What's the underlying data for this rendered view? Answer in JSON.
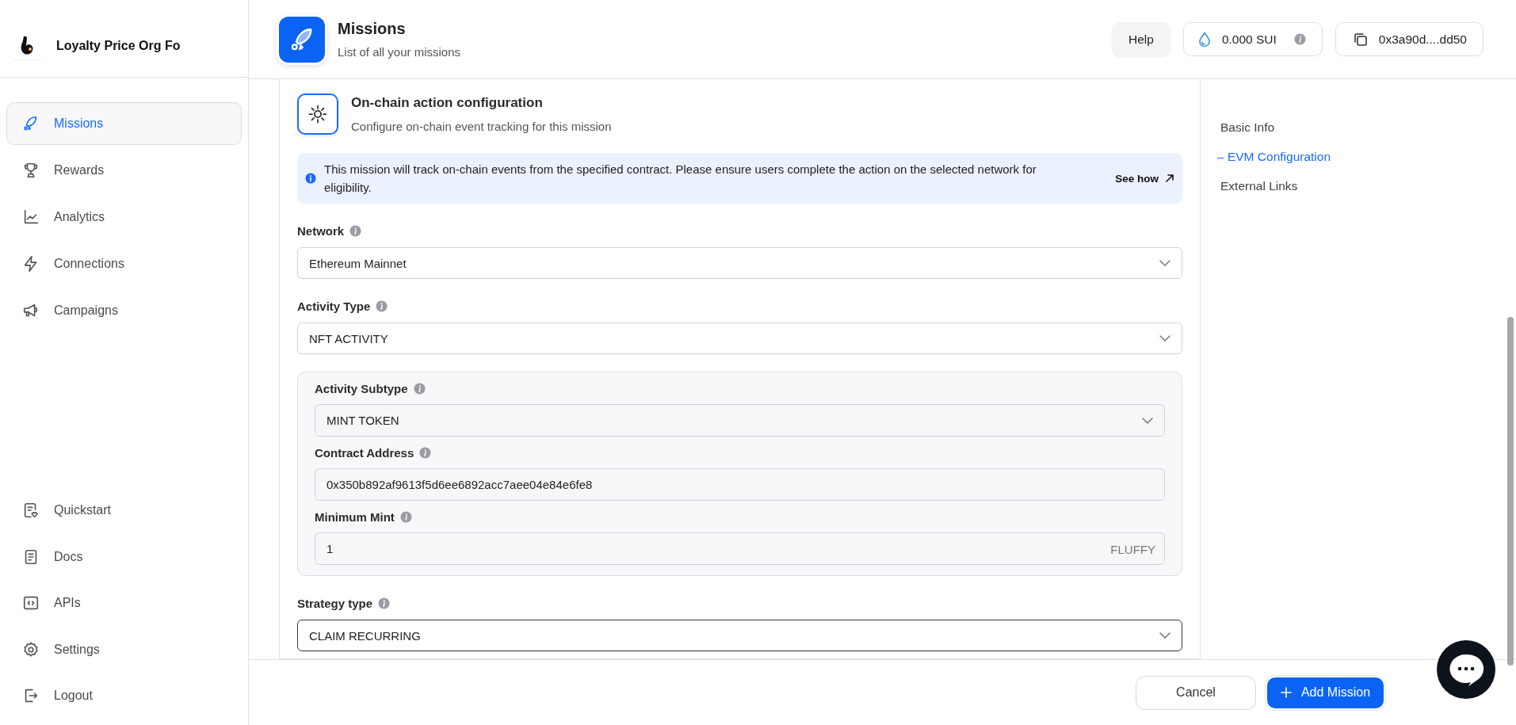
{
  "sidebar": {
    "org_name": "Loyalty Price Org Fo",
    "items": [
      {
        "label": "Missions",
        "selected": true
      },
      {
        "label": "Rewards",
        "selected": false
      },
      {
        "label": "Analytics",
        "selected": false
      },
      {
        "label": "Connections",
        "selected": false
      },
      {
        "label": "Campaigns",
        "selected": false
      }
    ],
    "bottom_items": [
      {
        "label": "Quickstart"
      },
      {
        "label": "Docs"
      },
      {
        "label": "APIs"
      },
      {
        "label": "Settings"
      },
      {
        "label": "Logout"
      }
    ]
  },
  "header": {
    "title": "Missions",
    "subtitle": "List of all your missions",
    "help_button": "Help",
    "balance": "0.000 SUI",
    "wallet_address": "0x3a90d....dd50"
  },
  "config": {
    "title": "On-chain action configuration",
    "subtitle": "Configure on-chain event tracking for this mission",
    "notice": {
      "text": "This mission will track on-chain events from the specified contract. Please ensure users complete the action on the selected network for eligibility.",
      "link": "See how"
    },
    "fields": [
      {
        "kind": "select",
        "label": "Network",
        "value": "Ethereum Mainnet",
        "focused": false
      },
      {
        "kind": "select",
        "label": "Activity Type",
        "value": "NFT ACTIVITY",
        "focused": false
      },
      {
        "kind": "group",
        "fields": [
          {
            "kind": "select",
            "label": "Activity Subtype",
            "value": "MINT TOKEN",
            "focused": false
          },
          {
            "kind": "input",
            "label": "Contract Address",
            "value": "0x350b892af9613f5d6ee6892acc7aee04e84e6fe8",
            "focused": false
          },
          {
            "kind": "input",
            "label": "Minimum Mint",
            "value": "1",
            "suffix": "FLUFFY",
            "focused": false
          }
        ]
      },
      {
        "kind": "select",
        "label": "Strategy type",
        "value": "CLAIM RECURRING",
        "focused": true
      }
    ]
  },
  "section_nav": [
    {
      "label": "Basic Info",
      "selected": false
    },
    {
      "label": "– EVM Configuration",
      "selected": true
    },
    {
      "label": "External Links",
      "selected": false
    }
  ],
  "footer": {
    "cancel_button": "Cancel",
    "add_button": "Add Mission"
  }
}
